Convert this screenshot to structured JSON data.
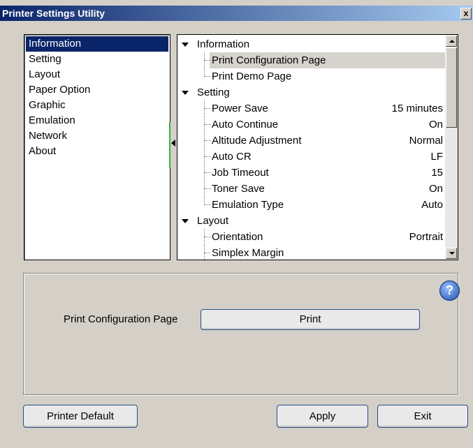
{
  "window": {
    "title": "Printer Settings Utility",
    "close_glyph": "x"
  },
  "nav": {
    "items": [
      {
        "label": "Information",
        "selected": true
      },
      {
        "label": "Setting"
      },
      {
        "label": "Layout"
      },
      {
        "label": "Paper Option"
      },
      {
        "label": "Graphic"
      },
      {
        "label": "Emulation"
      },
      {
        "label": "Network"
      },
      {
        "label": "About"
      }
    ]
  },
  "tree": {
    "information": {
      "label": "Information",
      "print_config": "Print Configuration Page",
      "print_demo": "Print Demo Page"
    },
    "setting": {
      "label": "Setting",
      "items": [
        {
          "label": "Power Save",
          "value": "15 minutes"
        },
        {
          "label": "Auto Continue",
          "value": "On"
        },
        {
          "label": "Altitude Adjustment",
          "value": "Normal"
        },
        {
          "label": "Auto CR",
          "value": "LF"
        },
        {
          "label": "Job Timeout",
          "value": "15"
        },
        {
          "label": "Toner Save",
          "value": "On"
        },
        {
          "label": "Emulation Type",
          "value": "Auto"
        }
      ]
    },
    "layout": {
      "label": "Layout",
      "items": [
        {
          "label": "Orientation",
          "value": "Portrait"
        },
        {
          "label": "Simplex Margin",
          "value": ""
        }
      ]
    }
  },
  "panel": {
    "help_glyph": "?",
    "label": "Print Configuration Page",
    "print_button": "Print"
  },
  "footer": {
    "printer_default": "Printer Default",
    "apply": "Apply",
    "exit": "Exit"
  }
}
